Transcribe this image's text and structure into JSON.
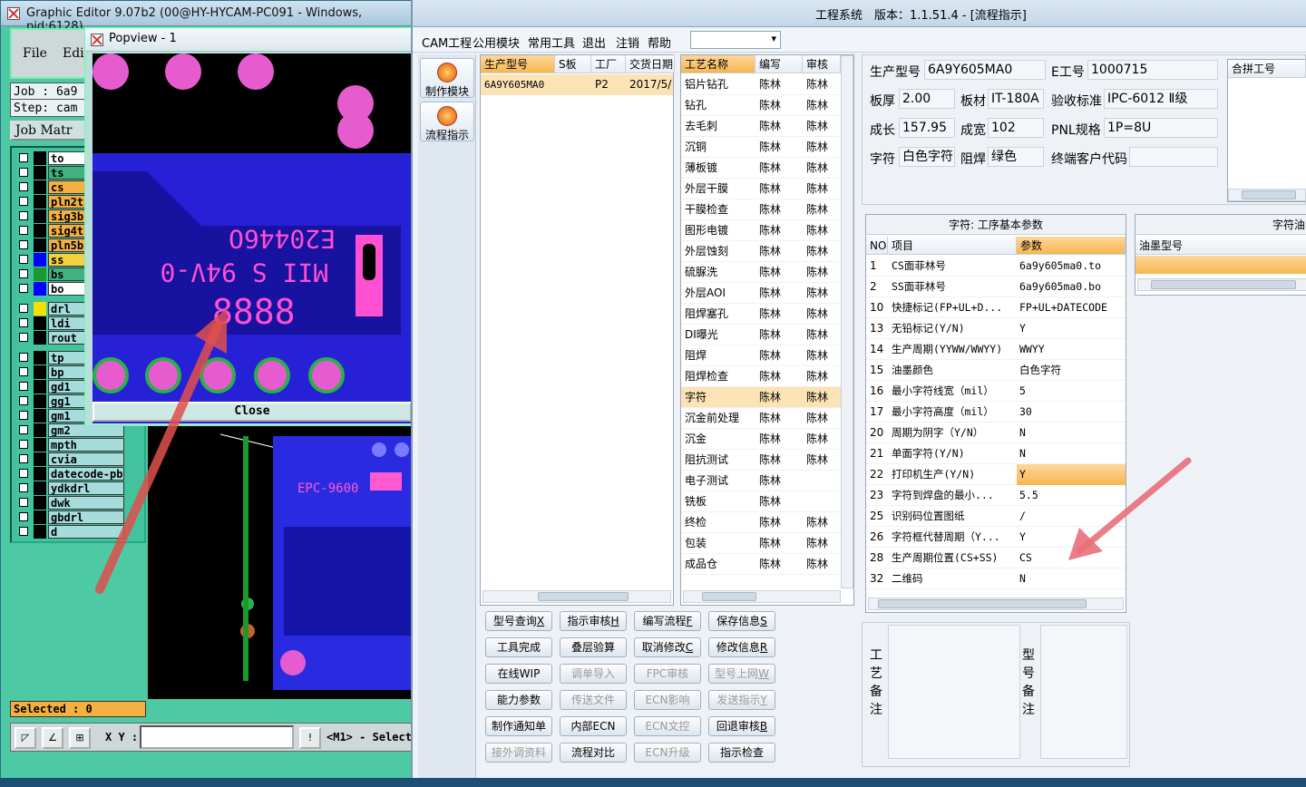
{
  "graphic_editor": {
    "title": "Graphic Editor 9.07b2 (00@HY-HYCAM-PC091 - Windows, pid:6128)",
    "menu": [
      "File",
      "Edit"
    ],
    "job_line": "Job : 6a9",
    "step_line": "Step: cam",
    "job_matrix_label": "Job Matr",
    "layers": [
      {
        "name": "to",
        "color": "#000000",
        "name_bg": "#ffffff"
      },
      {
        "name": "ts",
        "color": "#000000",
        "name_bg": "#3fb27f"
      },
      {
        "name": "cs",
        "color": "#000000",
        "name_bg": "#f5b042"
      },
      {
        "name": "pln2t",
        "color": "#000000",
        "name_bg": "#f5b042"
      },
      {
        "name": "sig3b",
        "color": "#000000",
        "name_bg": "#f5b042"
      },
      {
        "name": "sig4t",
        "color": "#000000",
        "name_bg": "#f5b042"
      },
      {
        "name": "pln5b",
        "color": "#000000",
        "name_bg": "#f5b042"
      },
      {
        "name": "ss",
        "color": "#0000ff",
        "name_bg": "#f5d040"
      },
      {
        "name": "bs",
        "color": "#1a9a2a",
        "name_bg": "#3fb27f"
      },
      {
        "name": "bo",
        "color": "#0000ff",
        "name_bg": "#ffffff"
      },
      {
        "name": "drl",
        "color": "#f5e000",
        "name_bg": "#a7dcdc"
      },
      {
        "name": "ldi",
        "color": "#000000",
        "name_bg": "#a7dcdc"
      },
      {
        "name": "rout",
        "color": "#000000",
        "name_bg": "#a7dcdc"
      },
      {
        "name": "tp",
        "color": "#000000",
        "name_bg": "#a7dcdc"
      },
      {
        "name": "bp",
        "color": "#000000",
        "name_bg": "#a7dcdc"
      },
      {
        "name": "gd1",
        "color": "#000000",
        "name_bg": "#a7dcdc"
      },
      {
        "name": "gg1",
        "color": "#000000",
        "name_bg": "#a7dcdc"
      },
      {
        "name": "gm1",
        "color": "#000000",
        "name_bg": "#a7dcdc"
      },
      {
        "name": "gm2",
        "color": "#000000",
        "name_bg": "#a7dcdc"
      },
      {
        "name": "mpth",
        "color": "#000000",
        "name_bg": "#a7dcdc"
      },
      {
        "name": "cvia",
        "color": "#000000",
        "name_bg": "#a7dcdc"
      },
      {
        "name": "datecode-pbe",
        "color": "#000000",
        "name_bg": "#a7dcdc"
      },
      {
        "name": "ydkdrl",
        "color": "#000000",
        "name_bg": "#a7dcdc"
      },
      {
        "name": "dwk",
        "color": "#000000",
        "name_bg": "#a7dcdc"
      },
      {
        "name": "gbdrl",
        "color": "#000000",
        "name_bg": "#a7dcdc"
      },
      {
        "name": "d",
        "color": "#000000",
        "name_bg": "#a7dcdc"
      }
    ],
    "selected": "Selected : 0",
    "xy_label": "X Y :",
    "mode_text": "<M1> - Select"
  },
  "popview": {
    "title": "Popview - 1",
    "close": "Close",
    "silk_text": [
      "E20446O",
      "MII S 94V-0",
      "8888"
    ],
    "pcb_text": [
      "EPC-9600"
    ]
  },
  "main_window": {
    "title": "工程系统　版本：1.1.51.4 - [流程指示]",
    "menu": [
      "CAM工程",
      "公用模块",
      "常用工具",
      "退出",
      "注销",
      "帮助"
    ],
    "side_buttons": [
      "制作模块",
      "流程指示"
    ],
    "orders": {
      "headers": [
        "生产型号",
        "S板",
        "工厂",
        "交货日期"
      ],
      "rows": [
        [
          "6A9Y605MA0",
          "",
          "P2",
          "2017/5/"
        ]
      ]
    },
    "process": {
      "headers": [
        "工艺名称",
        "编写",
        "审核"
      ],
      "rows": [
        [
          "铝片钻孔",
          "陈林",
          "陈林"
        ],
        [
          "钻孔",
          "陈林",
          "陈林"
        ],
        [
          "去毛刺",
          "陈林",
          "陈林"
        ],
        [
          "沉铜",
          "陈林",
          "陈林"
        ],
        [
          "薄板镀",
          "陈林",
          "陈林"
        ],
        [
          "外层干膜",
          "陈林",
          "陈林"
        ],
        [
          "干膜检查",
          "陈林",
          "陈林"
        ],
        [
          "图形电镀",
          "陈林",
          "陈林"
        ],
        [
          "外层蚀刻",
          "陈林",
          "陈林"
        ],
        [
          "硫脲洗",
          "陈林",
          "陈林"
        ],
        [
          "外层AOI",
          "陈林",
          "陈林"
        ],
        [
          "阻焊塞孔",
          "陈林",
          "陈林"
        ],
        [
          "DI曝光",
          "陈林",
          "陈林"
        ],
        [
          "阻焊",
          "陈林",
          "陈林"
        ],
        [
          "阻焊检查",
          "陈林",
          "陈林"
        ],
        [
          "字符",
          "陈林",
          "陈林"
        ],
        [
          "沉金前处理",
          "陈林",
          "陈林"
        ],
        [
          "沉金",
          "陈林",
          "陈林"
        ],
        [
          "阻抗测试",
          "陈林",
          "陈林"
        ],
        [
          "电子测试",
          "陈林",
          ""
        ],
        [
          "铣板",
          "陈林",
          ""
        ],
        [
          "终检",
          "陈林",
          "陈林"
        ],
        [
          "包装",
          "陈林",
          "陈林"
        ],
        [
          "成品仓",
          "陈林",
          "陈林"
        ]
      ],
      "selected_index": 15
    },
    "info": {
      "model_label": "生产型号",
      "model": "6A9Y605MA0",
      "eno_label": "E工号",
      "eno": "1000715",
      "thick_label": "板厚",
      "thick": "2.00",
      "mat_label": "板材",
      "mat": "IT-180A",
      "std_label": "验收标准",
      "std": "IPC-6012 Ⅱ级",
      "len_label": "成长",
      "len": "157.95",
      "wid_label": "成宽",
      "wid": "102",
      "pnl_label": "PNL规格",
      "pnl": "1P=8U",
      "char_label": "字符",
      "char": "白色字符",
      "mask_label": "阻焊",
      "mask": "绿色",
      "cust_label": "终端客户代码",
      "cust": "",
      "merge_header": "合拼工号"
    },
    "params": {
      "title": "字符: 工序基本参数",
      "headers": [
        "NO",
        "项目",
        "参数"
      ],
      "rows": [
        [
          "1",
          "CS面菲林号",
          "6a9y605ma0.to"
        ],
        [
          "2",
          "SS面菲林号",
          "6a9y605ma0.bo"
        ],
        [
          "10",
          "快捷标记(FP+UL+D...",
          "FP+UL+DATECODE"
        ],
        [
          "13",
          "无铅标记(Y/N)",
          "Y"
        ],
        [
          "14",
          "生产周期(YYWW/WWYY)",
          "WWYY"
        ],
        [
          "15",
          "油墨颜色",
          "白色字符"
        ],
        [
          "16",
          "最小字符线宽（mil）",
          "5"
        ],
        [
          "17",
          "最小字符高度（mil）",
          "30"
        ],
        [
          "20",
          "周期为阴字（Y/N）",
          "N"
        ],
        [
          "21",
          "单面字符(Y/N)",
          "N"
        ],
        [
          "22",
          "打印机生产(Y/N)",
          "Y"
        ],
        [
          "23",
          "字符到焊盘的最小...",
          "5.5"
        ],
        [
          "25",
          "识别码位置图纸",
          "/"
        ],
        [
          "26",
          "字符框代替周期（Y...",
          "Y"
        ],
        [
          "28",
          "生产周期位置(CS+SS)",
          "CS"
        ],
        [
          "32",
          "二维码",
          "N"
        ]
      ],
      "highlight_index": 10
    },
    "ink": {
      "title": "字符油",
      "header": "油墨型号"
    },
    "remarks": {
      "process_label": "工艺备注",
      "model_label": "型号备注"
    },
    "actions": [
      [
        {
          "label": "型号查询",
          "key": "X",
          "enabled": true
        },
        {
          "label": "指示审核",
          "key": "H",
          "enabled": true
        },
        {
          "label": "编写流程",
          "key": "F",
          "enabled": true
        },
        {
          "label": "保存信息",
          "key": "S",
          "enabled": true
        }
      ],
      [
        {
          "label": "工具完成",
          "key": "",
          "enabled": true
        },
        {
          "label": "叠层验算",
          "key": "",
          "enabled": true
        },
        {
          "label": "取消修改",
          "key": "C",
          "enabled": true
        },
        {
          "label": "修改信息",
          "key": "R",
          "enabled": true
        }
      ],
      [
        {
          "label": "在线WIP",
          "key": "",
          "enabled": true
        },
        {
          "label": "调单导入",
          "key": "",
          "enabled": false
        },
        {
          "label": "FPC审核",
          "key": "",
          "enabled": false
        },
        {
          "label": "型号上网",
          "key": "W",
          "enabled": false
        }
      ],
      [
        {
          "label": "能力参数",
          "key": "",
          "enabled": true
        },
        {
          "label": "传送文件",
          "key": "",
          "enabled": false
        },
        {
          "label": "ECN影响",
          "key": "",
          "enabled": false
        },
        {
          "label": "发送指示",
          "key": "Y",
          "enabled": false
        }
      ],
      [
        {
          "label": "制作通知单",
          "key": "",
          "enabled": true
        },
        {
          "label": "内部ECN",
          "key": "",
          "enabled": true
        },
        {
          "label": "ECN文控",
          "key": "",
          "enabled": false
        },
        {
          "label": "回退审核",
          "key": "B",
          "enabled": true
        }
      ],
      [
        {
          "label": "接外调资料",
          "key": "",
          "enabled": false
        },
        {
          "label": "流程对比",
          "key": "",
          "enabled": true
        },
        {
          "label": "ECN升级",
          "key": "",
          "enabled": false
        },
        {
          "label": "指示检查",
          "key": "",
          "enabled": true
        }
      ]
    ]
  }
}
